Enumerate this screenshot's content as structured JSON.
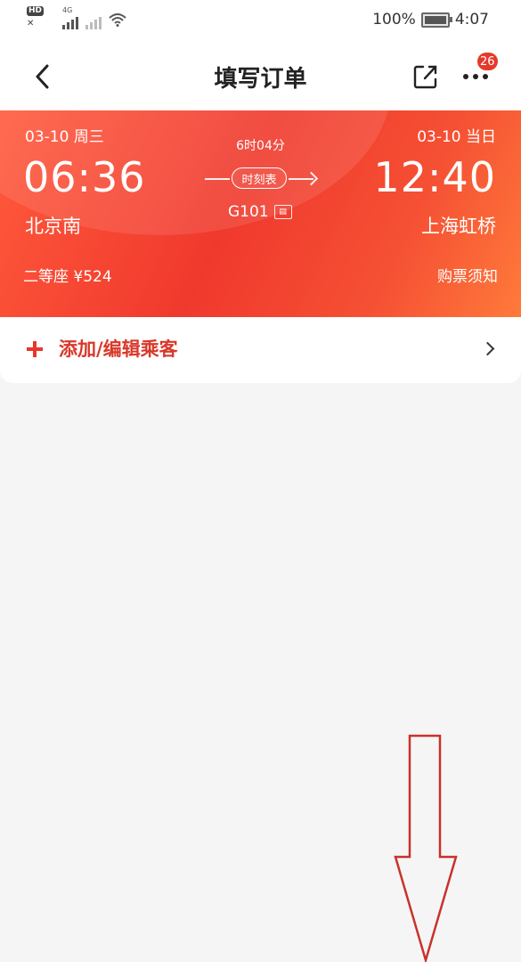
{
  "status_bar": {
    "hd_label": "HD",
    "network_label": "4G",
    "battery_percent": "100%",
    "time": "4:07"
  },
  "header": {
    "title": "填写订单",
    "badge_count": "26",
    "icons": [
      "back-arrow-icon",
      "share-icon",
      "more-icon"
    ]
  },
  "train": {
    "departure_date": "03-10 周三",
    "arrival_date": "03-10 当日",
    "departure_time": "06:36",
    "arrival_time": "12:40",
    "departure_station": "北京南",
    "arrival_station": "上海虹桥",
    "duration": "6时04分",
    "timetable_label": "时刻表",
    "train_number": "G101",
    "seat_class_price": "二等座 ¥524",
    "notice_label": "购票须知"
  },
  "passenger": {
    "add_label": "添加/编辑乘客"
  },
  "colors": {
    "card_red": "#f0392d",
    "accent_text": "#d9382a",
    "badge_red": "#e53a2b",
    "annotation_arrow": "#c8322a"
  }
}
